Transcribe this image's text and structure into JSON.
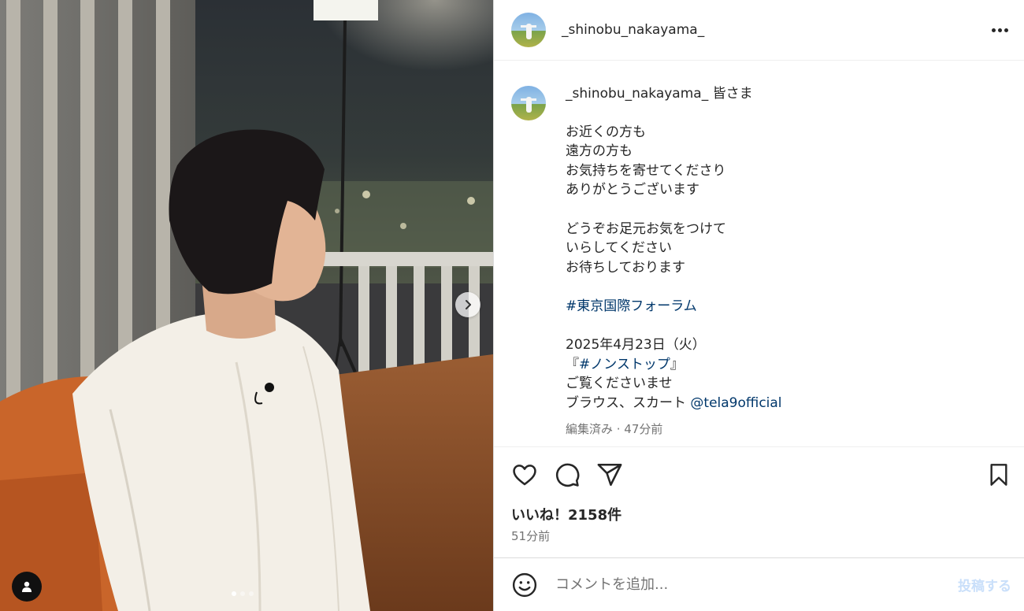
{
  "header": {
    "username": "_shinobu_nakayama_"
  },
  "caption": {
    "username": "_shinobu_nakayama_",
    "intro": "皆さま",
    "lines_block": "お近くの方も\n遠方の方も\nお気持ちを寄せてくださり\nありがとうございます\n\nどうぞお足元お気をつけて\nいらしてください\nお待ちしております\n\n",
    "hashtag1": "#東京国際フォーラム",
    "date_line": "2025年4月23日（火）",
    "bracket_open": "『",
    "hashtag2": "#ノンストップ",
    "bracket_close": "』",
    "line_watch": "ご覧くださいませ",
    "credit_prefix": "ブラウス、スカート",
    "mention": "@tela9official",
    "meta": "編集済み · 47分前"
  },
  "stats": {
    "likes": "いいね！2158件",
    "time": "51分前"
  },
  "comment": {
    "placeholder": "コメントを追加...",
    "post_label": "投稿する"
  },
  "carousel": {
    "total_slides": 3,
    "current_slide": 1
  },
  "icons": {
    "next": "chevron-right-icon",
    "user_tag": "user-icon",
    "more": "more-horizontal-icon",
    "like": "heart-icon",
    "comment": "comment-icon",
    "share": "share-icon",
    "save": "bookmark-icon",
    "emoji": "emoji-icon"
  },
  "colors": {
    "link": "#00376b",
    "muted": "#737373",
    "post_button_disabled": "#c9dffa"
  }
}
